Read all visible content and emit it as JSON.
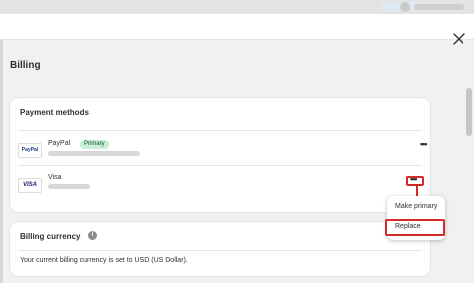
{
  "modal": {
    "title": "Billing"
  },
  "payment_methods": {
    "title": "Payment methods",
    "items": [
      {
        "name": "PayPal",
        "logo": "PayPal",
        "badge": "Primary",
        "more": "•••"
      },
      {
        "name": "Visa",
        "logo": "VISA",
        "more": "•••"
      }
    ]
  },
  "menu": {
    "items": [
      "Make primary",
      "Replace"
    ]
  },
  "billing_currency": {
    "title": "Billing currency",
    "info_icon": "i",
    "text": "Your current billing currency is set to USD (US Dollar)."
  },
  "colors": {
    "highlight": "#d42a2a",
    "badge_bg": "#c8f0db",
    "badge_text": "#0c5132"
  }
}
